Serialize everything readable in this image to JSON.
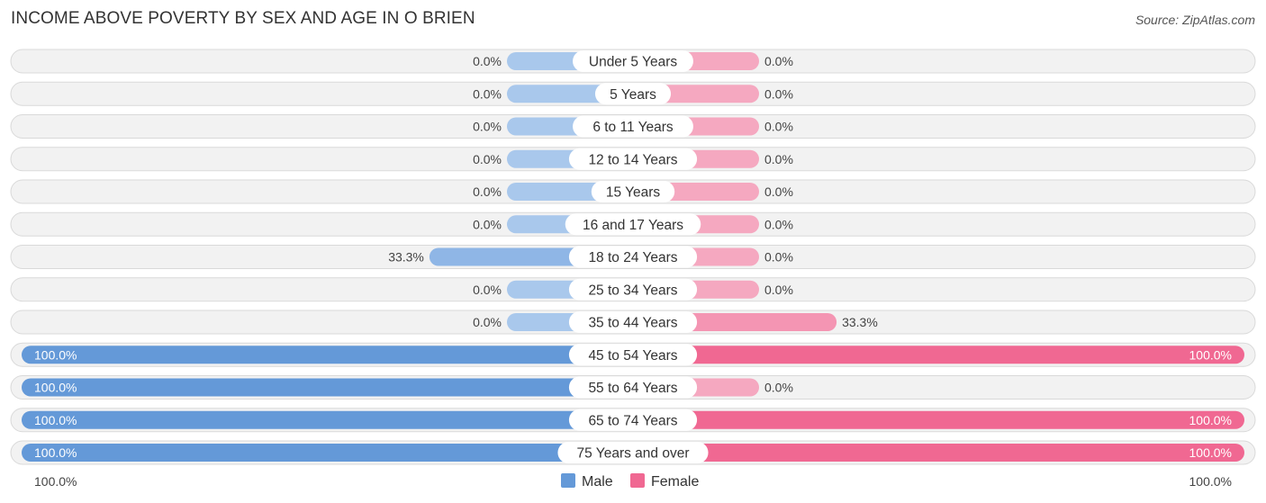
{
  "chart_data": {
    "type": "bar",
    "orientation": "horizontal-diverging",
    "title": "INCOME ABOVE POVERTY BY SEX AND AGE IN O BRIEN",
    "source": "Source: ZipAtlas.com",
    "categories": [
      "Under 5 Years",
      "5 Years",
      "6 to 11 Years",
      "12 to 14 Years",
      "15 Years",
      "16 and 17 Years",
      "18 to 24 Years",
      "25 to 34 Years",
      "35 to 44 Years",
      "45 to 54 Years",
      "55 to 64 Years",
      "65 to 74 Years",
      "75 Years and over"
    ],
    "series": [
      {
        "name": "Male",
        "color": "#6499d8",
        "color_light": "#a9c8ec",
        "values": [
          0.0,
          0.0,
          0.0,
          0.0,
          0.0,
          0.0,
          33.3,
          0.0,
          0.0,
          100.0,
          100.0,
          100.0,
          100.0
        ],
        "labels": [
          "0.0%",
          "0.0%",
          "0.0%",
          "0.0%",
          "0.0%",
          "0.0%",
          "33.3%",
          "0.0%",
          "0.0%",
          "100.0%",
          "100.0%",
          "100.0%",
          "100.0%"
        ]
      },
      {
        "name": "Female",
        "color": "#f06892",
        "color_light": "#f5a8c0",
        "values": [
          0.0,
          0.0,
          0.0,
          0.0,
          0.0,
          0.0,
          0.0,
          0.0,
          33.3,
          100.0,
          0.0,
          100.0,
          100.0
        ],
        "labels": [
          "0.0%",
          "0.0%",
          "0.0%",
          "0.0%",
          "0.0%",
          "0.0%",
          "0.0%",
          "0.0%",
          "33.3%",
          "100.0%",
          "0.0%",
          "100.0%",
          "100.0%"
        ]
      }
    ],
    "xlim": [
      -100,
      100
    ],
    "axis_labels": {
      "left": "100.0%",
      "right": "100.0%"
    },
    "legend": {
      "position": "bottom-center",
      "items": [
        "Male",
        "Female"
      ]
    },
    "grid": false
  }
}
